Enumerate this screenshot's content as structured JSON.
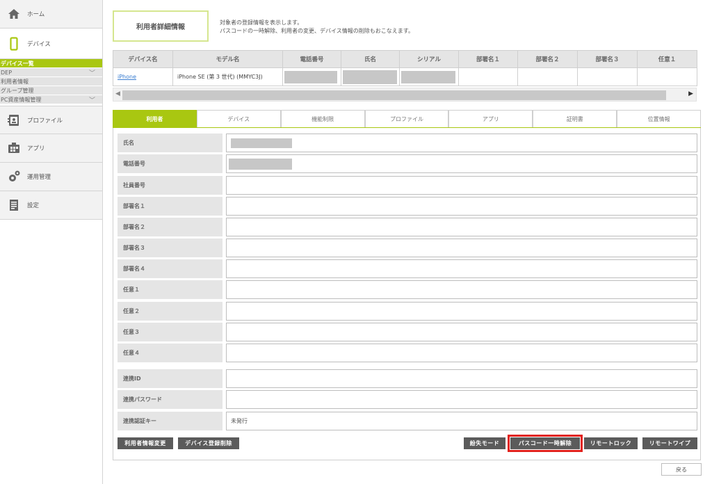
{
  "sidebar": {
    "items": [
      {
        "label": "ホーム",
        "icon": "home-icon"
      },
      {
        "label": "デバイス",
        "icon": "smartphone-icon"
      },
      {
        "label": "プロファイル",
        "icon": "profile-icon"
      },
      {
        "label": "アプリ",
        "icon": "app-icon"
      },
      {
        "label": "運用管理",
        "icon": "gear-icon"
      },
      {
        "label": "設定",
        "icon": "document-icon"
      }
    ],
    "device_sub": [
      {
        "label": "デバイス一覧",
        "selected": true,
        "chevron": false
      },
      {
        "label": "DEP",
        "selected": false,
        "chevron": true
      },
      {
        "label": "利用者情報",
        "selected": false,
        "chevron": false
      },
      {
        "label": "グループ管理",
        "selected": false,
        "chevron": false
      },
      {
        "label": "PC資産情報管理",
        "selected": false,
        "chevron": true
      }
    ]
  },
  "header": {
    "title": "利用者詳細情報",
    "desc_line1": "対象者の登録情報を表示します。",
    "desc_line2": "パスコードの一時解除、利用者の変更、デバイス情報の削除もおこなえます。"
  },
  "device_table": {
    "columns": [
      "デバイス名",
      "モデル名",
      "電話番号",
      "氏名",
      "シリアル",
      "部署名１",
      "部署名２",
      "部署名３",
      "任意１"
    ],
    "row": {
      "device_name": "iPhone",
      "model": "iPhone SE (第 3 世代) (MMYC3J)"
    }
  },
  "tabs": [
    "利用者",
    "デバイス",
    "機能制限",
    "プロファイル",
    "アプリ",
    "証明書",
    "位置情報"
  ],
  "form": {
    "rows": [
      {
        "label": "氏名",
        "value": ""
      },
      {
        "label": "電話番号",
        "value": ""
      },
      {
        "label": "社員番号",
        "value": ""
      },
      {
        "label": "部署名１",
        "value": ""
      },
      {
        "label": "部署名２",
        "value": ""
      },
      {
        "label": "部署名３",
        "value": ""
      },
      {
        "label": "部署名４",
        "value": ""
      },
      {
        "label": "任意１",
        "value": ""
      },
      {
        "label": "任意２",
        "value": ""
      },
      {
        "label": "任意３",
        "value": ""
      },
      {
        "label": "任意４",
        "value": ""
      },
      {
        "label": "連携ID",
        "value": ""
      },
      {
        "label": "連携パスワード",
        "value": ""
      },
      {
        "label": "連携認証キー",
        "value": "未発行"
      }
    ]
  },
  "buttons": {
    "change_user": "利用者情報変更",
    "delete_device": "デバイス登録削除",
    "lost_mode": "紛失モード",
    "passcode_release": "パスコード一時解除",
    "remote_lock": "リモートロック",
    "remote_wipe": "リモートワイプ",
    "back": "戻る"
  },
  "colors": {
    "accent": "#a9c711",
    "highlight": "#e2211c",
    "button": "#5b5b5b"
  }
}
